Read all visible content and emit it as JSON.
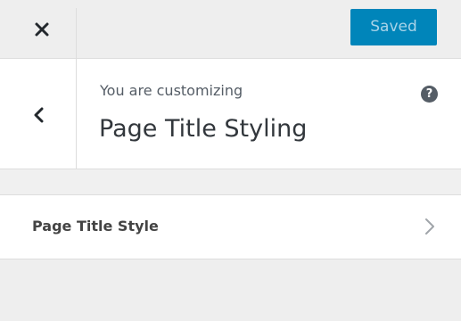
{
  "header": {
    "close_icon": "close-x-icon",
    "save_button_label": "Saved",
    "save_button_color": "#0085ba"
  },
  "panel": {
    "back_icon": "chevron-left-icon",
    "customizing_label": "You are customizing",
    "section_title": "Page Title Styling",
    "help_icon": "question-mark-icon",
    "help_symbol": "?"
  },
  "controls": {
    "items": [
      {
        "label": "Page Title Style",
        "icon": "chevron-right-icon"
      }
    ]
  }
}
